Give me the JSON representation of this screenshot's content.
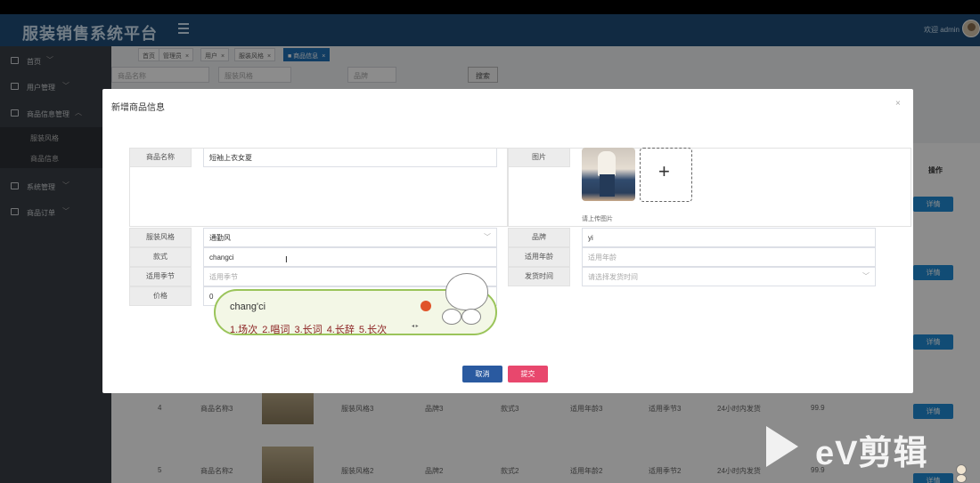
{
  "app": {
    "title": "服装销售系统平台",
    "welcome": "欢迎 admin"
  },
  "sidebar": {
    "items": [
      {
        "label": "首页",
        "arrow": "﹀"
      },
      {
        "label": "用户管理",
        "arrow": "﹀"
      },
      {
        "label": "商品信息管理",
        "arrow": "︿"
      },
      {
        "label": "服装风格"
      },
      {
        "label": "商品信息"
      },
      {
        "label": "系统管理",
        "arrow": "﹀"
      },
      {
        "label": "商品订单",
        "arrow": "﹀"
      }
    ]
  },
  "tabs": [
    {
      "label": "首页",
      "close": "×"
    },
    {
      "label": "管理员",
      "close": "×"
    },
    {
      "label": "用户",
      "close": "×"
    },
    {
      "label": "服装风格",
      "close": "×"
    },
    {
      "label": "■ 商品信息",
      "close": "×"
    }
  ],
  "filter": {
    "name": "商品名称",
    "style": "服装风格",
    "brand": "品牌",
    "search": "搜索"
  },
  "table": {
    "ops_header": "操作",
    "detail_label": "详情",
    "rows": [
      {
        "no": "4",
        "name": "商品名称3",
        "style": "服装风格3",
        "brand": "品牌3",
        "model": "款式3",
        "age": "适用年龄3",
        "season": "适用季节3",
        "ship": "24小时内发货",
        "price": "99.9"
      },
      {
        "no": "5",
        "name": "商品名称2",
        "style": "服装风格2",
        "brand": "品牌2",
        "model": "款式2",
        "age": "适用年龄2",
        "season": "适用季节2",
        "ship": "24小时内发货",
        "price": "99.9"
      }
    ]
  },
  "modal": {
    "title": "新增商品信息",
    "close": "×",
    "fields": {
      "name": {
        "label": "商品名称",
        "value": "短袖上衣女夏"
      },
      "style": {
        "label": "服装风格",
        "value": "通勤风"
      },
      "model": {
        "label": "款式",
        "value": "changci"
      },
      "season": {
        "label": "适用季节",
        "placeholder": "适用季节"
      },
      "price": {
        "label": "价格",
        "value": "0"
      },
      "image": {
        "label": "图片",
        "hint": "请上传图片",
        "add": "+"
      },
      "brand": {
        "label": "品牌",
        "value": "yi"
      },
      "age": {
        "label": "适用年龄",
        "placeholder": "适用年龄"
      },
      "ship": {
        "label": "发货时间",
        "placeholder": "请选择发货时间"
      }
    },
    "cancel": "取消",
    "submit": "提交"
  },
  "ime": {
    "input": "chang'ci",
    "candidates": "1.场次  2.唱词  3.长词  4.长辞  5.长次",
    "pager": "◂ ▸"
  },
  "watermark": {
    "text": "eV剪辑"
  }
}
